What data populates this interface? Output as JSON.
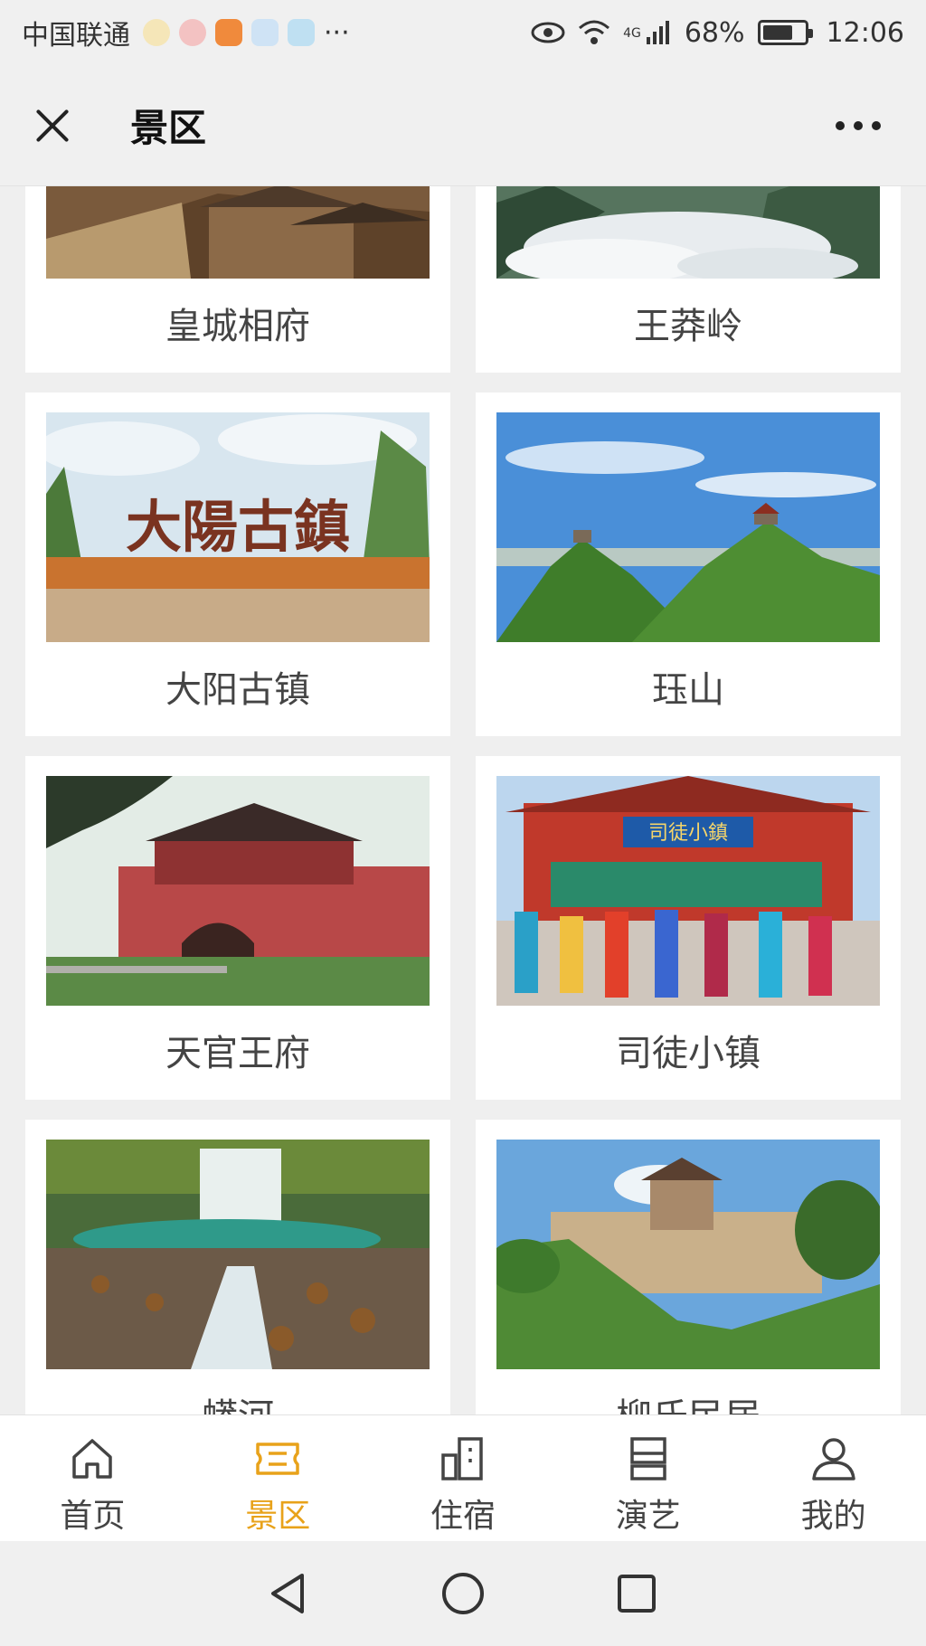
{
  "status": {
    "carrier": "中国联通",
    "more": "···",
    "network": "4G",
    "battery": "68%",
    "time": "12:06"
  },
  "nav": {
    "title": "景区"
  },
  "spots": [
    {
      "name": "皇城相府"
    },
    {
      "name": "王莽岭"
    },
    {
      "name": "大阳古镇",
      "sign": "大陽古鎮"
    },
    {
      "name": "珏山"
    },
    {
      "name": "天官王府"
    },
    {
      "name": "司徒小镇",
      "sign": "司徒小鎮"
    },
    {
      "name": "蟒河"
    },
    {
      "name": "柳氏民居"
    }
  ],
  "tabs": [
    {
      "label": "首页",
      "icon": "home-icon"
    },
    {
      "label": "景区",
      "icon": "ticket-icon"
    },
    {
      "label": "住宿",
      "icon": "building-icon"
    },
    {
      "label": "演艺",
      "icon": "stage-icon"
    },
    {
      "label": "我的",
      "icon": "user-icon"
    }
  ],
  "colors": {
    "accent": "#e8a21a",
    "background": "#efefef"
  }
}
